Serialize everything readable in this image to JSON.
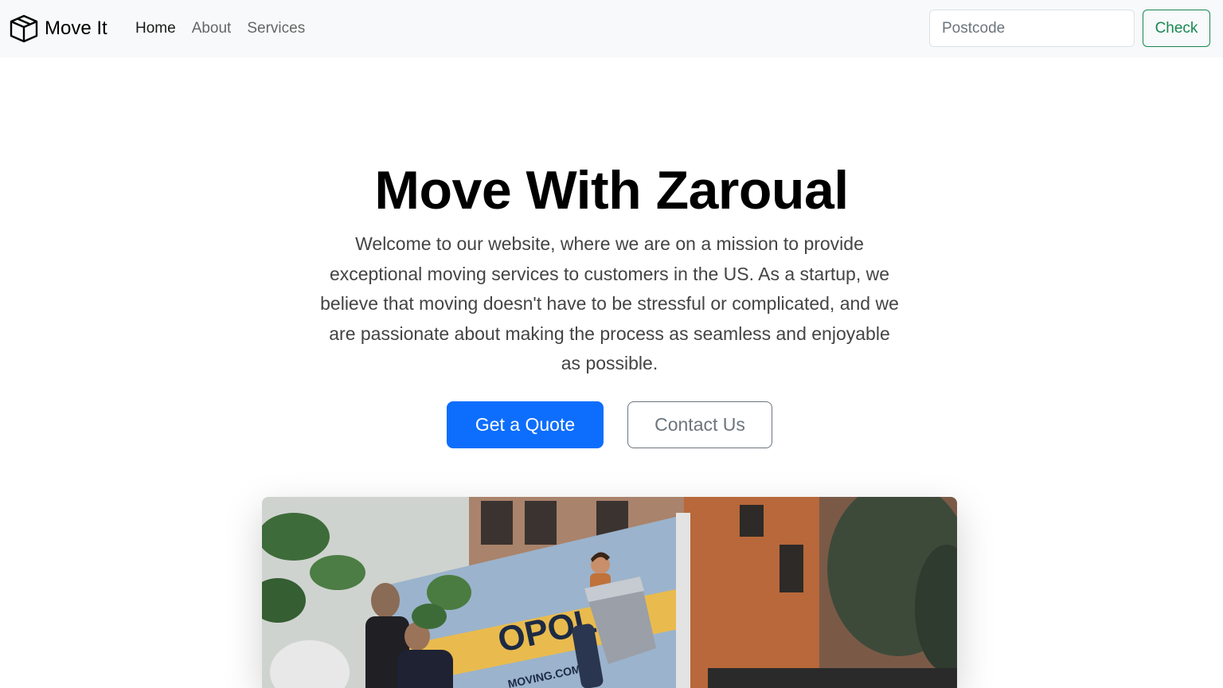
{
  "nav": {
    "brand": "Move It",
    "brand_icon": "box-icon",
    "links": [
      {
        "label": "Home",
        "active": true
      },
      {
        "label": "About",
        "active": false
      },
      {
        "label": "Services",
        "active": false
      }
    ],
    "postcode_placeholder": "Postcode",
    "check_label": "Check"
  },
  "hero": {
    "title": "Move With Zaroual",
    "text": "Welcome to our website, where we are on a mission to provide exceptional moving services to customers in the US. As a startup, we believe that moving doesn't have to be stressful or complicated, and we are passionate about making the process as seamless and enjoyable as possible.",
    "primary_button": "Get a Quote",
    "secondary_button": "Contact Us",
    "image_text": {
      "truck_brand": "OPOLIS",
      "truck_url": "MOVING.COM"
    }
  },
  "colors": {
    "primary": "#0d6efd",
    "success": "#198754",
    "secondary": "#6c757d",
    "navbar_bg": "#f8f9fa"
  }
}
